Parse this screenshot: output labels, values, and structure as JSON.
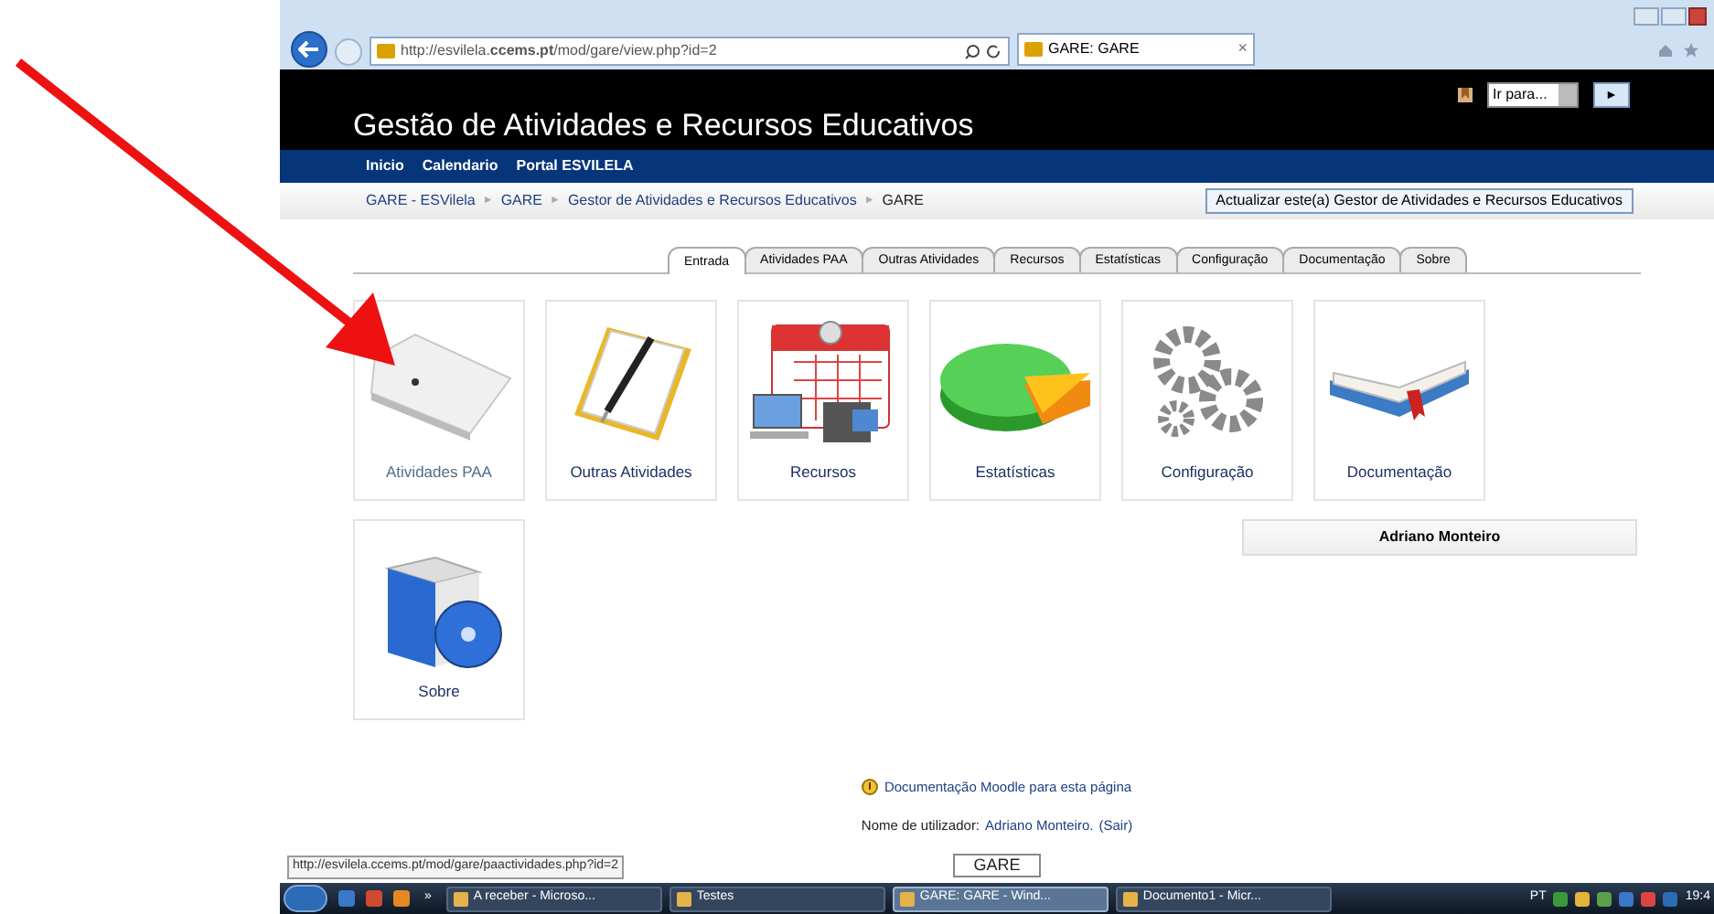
{
  "browser": {
    "address": "http://esvilela.**ccems.pt**/mod/gare/view.php?id=2",
    "tab": "GARE: GARE",
    "tab_close": "×"
  },
  "header": {
    "title": "Gestão de Atividades e Recursos Educativos",
    "jump": "Ir para...",
    "go": "►"
  },
  "nav": [
    "Inicio",
    "Calendario",
    "Portal ESVILELA"
  ],
  "breadcrumb": [
    "GARE - ESVilela",
    "GARE",
    "Gestor de Atividades e Recursos Educativos",
    "GARE"
  ],
  "breadcrumb_sep": "►",
  "update_button": "Actualizar este(a) Gestor de Atividades e Recursos Educativos",
  "tabs": [
    {
      "label": "Entrada",
      "selected": true
    },
    {
      "label": "Atividades PAA",
      "selected": false
    },
    {
      "label": "Outras Atividades",
      "selected": false
    },
    {
      "label": "Recursos",
      "selected": false
    },
    {
      "label": "Estatísticas",
      "selected": false
    },
    {
      "label": "Configuração",
      "selected": false
    },
    {
      "label": "Documentação",
      "selected": false
    },
    {
      "label": "Sobre",
      "selected": false
    }
  ],
  "tiles": [
    {
      "kind": "drive",
      "label": "Atividades PAA",
      "hovered": true
    },
    {
      "kind": "notepad",
      "label": "Outras Atividades",
      "hovered": false
    },
    {
      "kind": "calendar",
      "label": "Recursos",
      "hovered": false
    },
    {
      "kind": "pie",
      "label": "Estatísticas",
      "hovered": false
    },
    {
      "kind": "gears",
      "label": "Configuração",
      "hovered": false
    },
    {
      "kind": "book",
      "label": "Documentação",
      "hovered": false
    },
    {
      "kind": "box",
      "label": "Sobre",
      "hovered": false
    }
  ],
  "user_block": "Adriano Monteiro",
  "footer": {
    "doc_link": "Documentação Moodle para esta página",
    "login_label": "Nome de utilizador:",
    "user_link": "Adriano Monteiro.",
    "logout": "(Sair)",
    "course_button": "GARE"
  },
  "status_url": "http://esvilela.ccems.pt/mod/gare/paactividades.php?id=2",
  "taskbar": {
    "overflow": "»",
    "items": [
      {
        "label": "A receber - Microso...",
        "selected": false
      },
      {
        "label": "Testes",
        "selected": false
      },
      {
        "label": "GARE: GARE - Wind...",
        "selected": true
      },
      {
        "label": "Documento1 - Micr...",
        "selected": false
      }
    ],
    "language": "PT",
    "clock": "19:4"
  }
}
